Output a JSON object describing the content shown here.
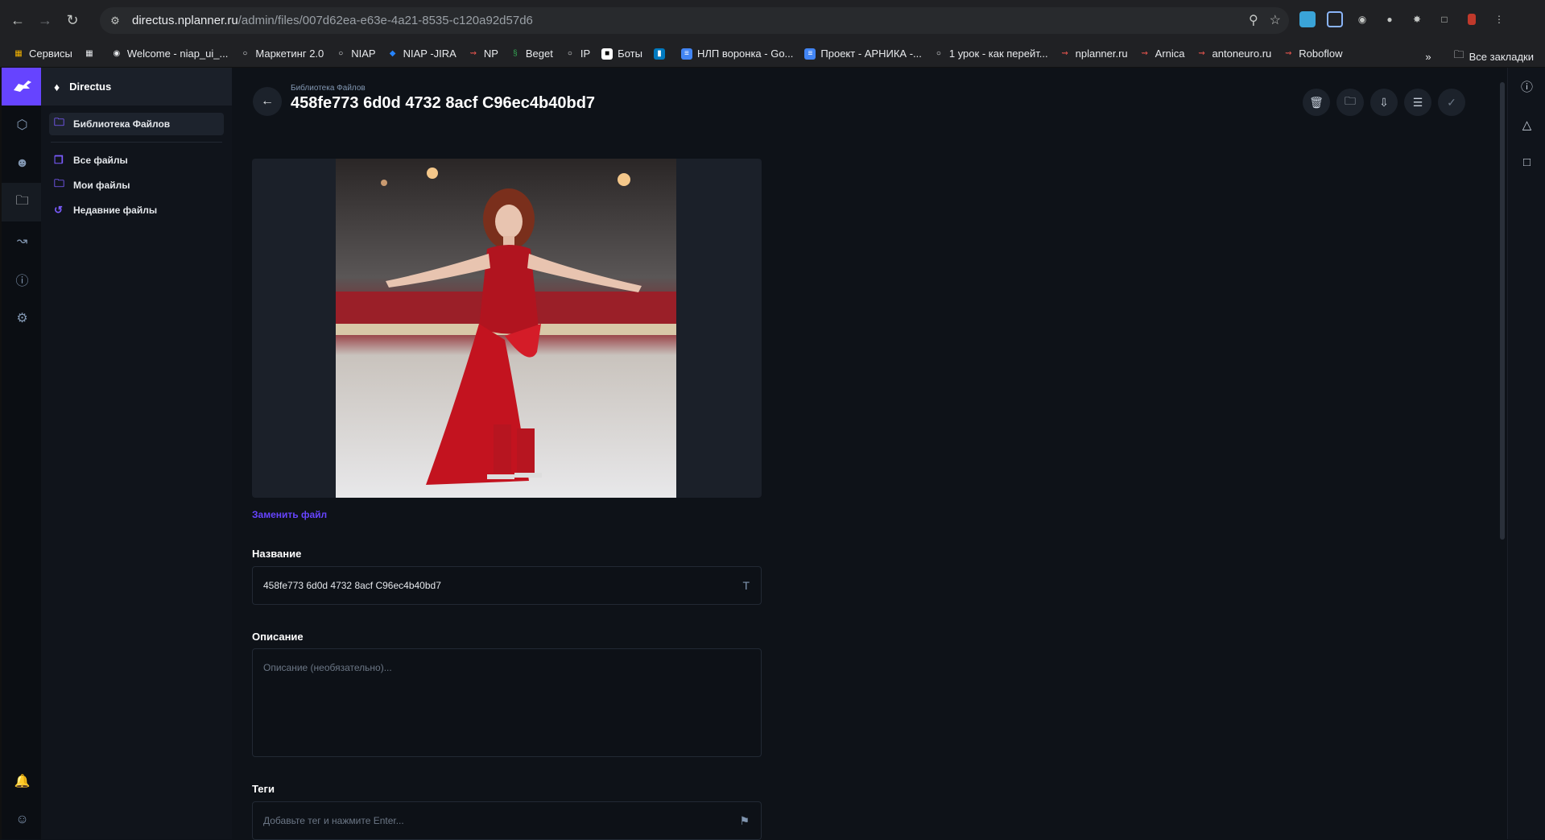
{
  "browser": {
    "url_host": "directus.nplanner.ru",
    "url_path": "/admin/files/007d62ea-e63e-4a21-8535-c120a92d57d6",
    "bookmarks": [
      "Сервисы",
      "Welcome - niap_ui_...",
      "Маркетинг 2.0",
      "NIAP",
      "NIAP -JIRA",
      "NP",
      "Beget",
      "IP",
      "Боты",
      "НЛП воронка - Go...",
      "Проект - АРНИКА -...",
      "1 урок - как перейт...",
      "nplanner.ru",
      "Arnica",
      "antoneuro.ru",
      "Roboflow"
    ],
    "all_bookmarks": "Все закладки"
  },
  "sidebar": {
    "project": "Directus",
    "section": "Библиотека Файлов",
    "items": [
      "Все файлы",
      "Мои файлы",
      "Недавние файлы"
    ]
  },
  "header": {
    "breadcrumb": "Библиотека Файлов",
    "title": "458fe773 6d0d 4732 8acf C96ec4b40bd7"
  },
  "form": {
    "replace_file": "Заменить файл",
    "title_label": "Название",
    "title_value": "458fe773 6d0d 4732 8acf C96ec4b40bd7",
    "description_label": "Описание",
    "description_placeholder": "Описание (необязательно)...",
    "tags_label": "Теги",
    "tags_placeholder": "Добавьте тег и нажмите Enter..."
  },
  "colors": {
    "accent": "#6644ff",
    "background": "#0e1218"
  }
}
